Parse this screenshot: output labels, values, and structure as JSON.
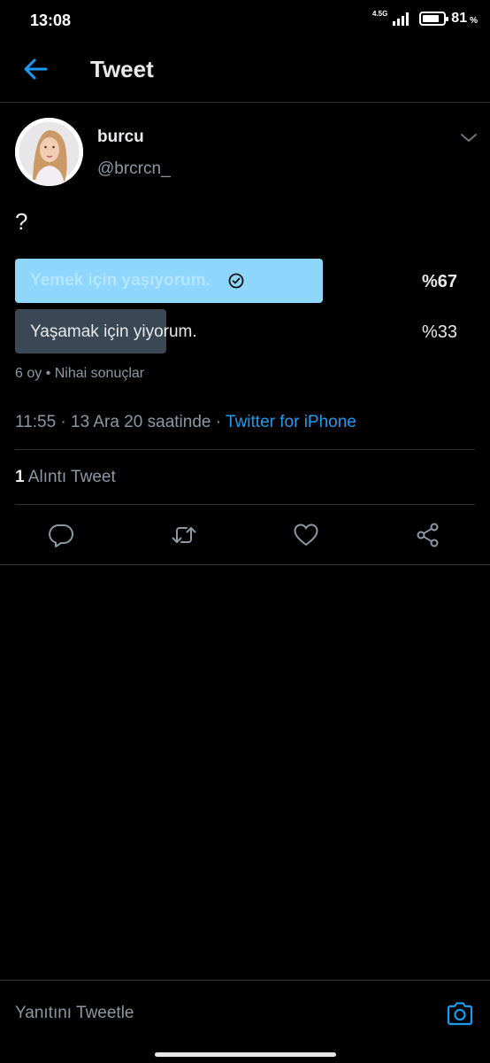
{
  "status_bar": {
    "time": "13:08",
    "network": "4.5G",
    "battery_level": 81,
    "battery_text": "81",
    "battery_unit": "%"
  },
  "header": {
    "title": "Tweet",
    "back_icon": "arrow-left-icon"
  },
  "tweet": {
    "author_name": "burcu",
    "author_handle": "@brcrcn_",
    "text": "?",
    "menu_icon": "chevron-down-icon",
    "poll": {
      "options": [
        {
          "label": "Yemek için yaşıyorum.",
          "percent_text": "%67",
          "percent": 67,
          "winner": true
        },
        {
          "label": "Yaşamak için yiyorum.",
          "percent_text": "%33",
          "percent": 33,
          "winner": false
        }
      ],
      "meta": "6 oy • Nihai sonuçlar"
    },
    "timestamp": "11:55 · 13 Ara 20 saatinde · ",
    "source": "Twitter for iPhone",
    "quote_count": "1",
    "quote_label": " Alıntı Tweet"
  },
  "actions": [
    {
      "name": "reply",
      "icon": "comment-icon"
    },
    {
      "name": "retweet",
      "icon": "retweet-icon"
    },
    {
      "name": "like",
      "icon": "heart-icon"
    },
    {
      "name": "share",
      "icon": "share-icon"
    }
  ],
  "reply_bar": {
    "placeholder": "Yanıtını Tweetle",
    "camera_icon": "camera-icon"
  },
  "colors": {
    "accent": "#1d9bf0",
    "background": "#000000",
    "winner_bar": "#8ed6fb",
    "loser_bar": "#3a4754",
    "secondary_text": "#8b98a5"
  }
}
